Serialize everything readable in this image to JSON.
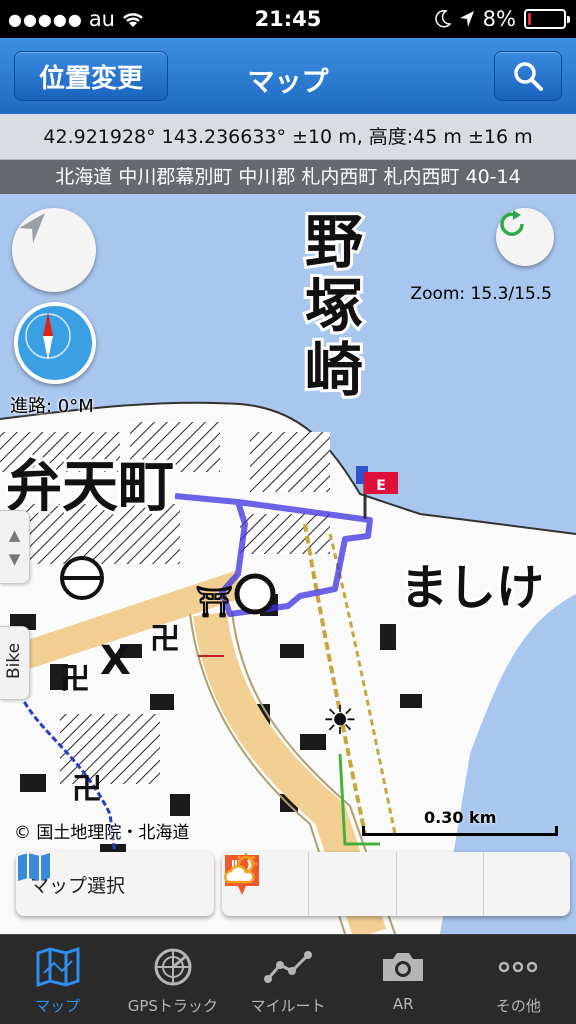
{
  "status_bar": {
    "carrier": "au",
    "time": "21:45",
    "battery_percent": "8%",
    "battery_level": 0.08,
    "icons": [
      "signal-dots-icon",
      "wifi-icon",
      "moon-icon",
      "location-arrow-icon",
      "battery-icon"
    ]
  },
  "nav": {
    "left_button": "位置変更",
    "title": "マップ",
    "search_icon": "search-icon"
  },
  "location": {
    "coords": "42.921928° 143.236633° ±10 m, 高度:45 m ±16 m",
    "address": "北海道 中川郡幕別町 中川郡 札内西町 札内西町 40-14"
  },
  "map": {
    "heading": "進路: 0°M",
    "zoom": "Zoom: 15.3/15.5",
    "side_tab": "Bike",
    "copyright": "© 国土地理院・北海道",
    "scale": "0.30 km",
    "flag_label": "E",
    "place_labels": {
      "nozuka": [
        "野",
        "塚",
        "崎"
      ],
      "bentencho": "弁天町",
      "mashike": "ましけ"
    }
  },
  "toolbar": {
    "map_select": "マップ選択",
    "tools": [
      "save-icon",
      "add-icon",
      "restaurant-icon",
      "weather-icon"
    ]
  },
  "tabs": [
    {
      "label": "マップ",
      "icon": "map-icon",
      "active": true
    },
    {
      "label": "GPSトラック",
      "icon": "gps-track-icon",
      "active": false
    },
    {
      "label": "マイルート",
      "icon": "my-route-icon",
      "active": false
    },
    {
      "label": "AR",
      "icon": "camera-icon",
      "active": false
    },
    {
      "label": "その他",
      "icon": "more-icon",
      "active": false
    }
  ],
  "colors": {
    "accent": "#2d8ff0",
    "navbar": "#1f6cc3",
    "sea": "#a9c6ee",
    "track": "#3a2fe0",
    "flag": "#e0103a"
  }
}
